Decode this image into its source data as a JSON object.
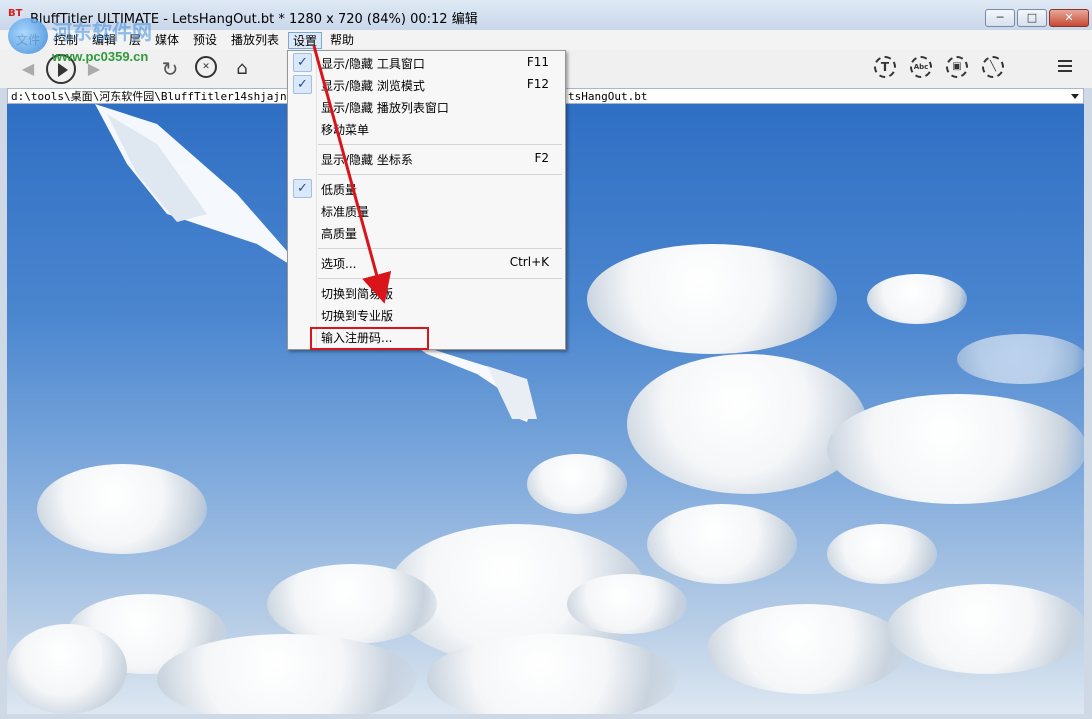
{
  "window": {
    "app_icon_text": "BT",
    "title": "BluffTitler ULTIMATE  - LetsHangOut.bt * 1280 x 720 (84%) 00:12 编辑",
    "minimize_label": "─",
    "maximize_label": "□",
    "close_label": "✕"
  },
  "watermark": {
    "title": "河东软件网",
    "url": "www.pc0359.cn"
  },
  "menubar": {
    "items": [
      "文件",
      "控制",
      "编辑",
      "层",
      "媒体",
      "预设",
      "播放列表",
      "设置",
      "帮助"
    ]
  },
  "toolbar": {
    "icons": {
      "back": "◀",
      "forward": "▶",
      "refresh": "↻",
      "stop": "✕",
      "home": "⌂",
      "text_layer": "T",
      "abc_layer": "Abc",
      "image_layer": "▣",
      "effect_layer": "╲"
    }
  },
  "pathbar": {
    "path_start": "d:\\tools\\桌面\\河东软件园\\BluffTitler14shjajnd\\",
    "path_end": "tsHangOut.bt"
  },
  "settings_menu": {
    "items": [
      {
        "label": "显示/隐藏 工具窗口",
        "shortcut": "F11",
        "checked": "✓"
      },
      {
        "label": "显示/隐藏 浏览模式",
        "shortcut": "F12",
        "checked": "✓"
      },
      {
        "label": "显示/隐藏 播放列表窗口",
        "shortcut": ""
      },
      {
        "label": "移动菜单",
        "shortcut": ""
      },
      {
        "label": "显示/隐藏 坐标系",
        "shortcut": "F2"
      },
      {
        "label": "低质量",
        "shortcut": "",
        "checked": "✓"
      },
      {
        "label": "标准质量",
        "shortcut": ""
      },
      {
        "label": "高质量",
        "shortcut": ""
      },
      {
        "label": "选项...",
        "shortcut": "Ctrl+K"
      },
      {
        "label": "切换到简易版",
        "shortcut": ""
      },
      {
        "label": "切换到专业版",
        "shortcut": ""
      },
      {
        "label": "输入注册码...",
        "shortcut": ""
      }
    ]
  },
  "colors": {
    "annotation_red": "#d9141b",
    "check_blue": "#1b4f9c"
  }
}
